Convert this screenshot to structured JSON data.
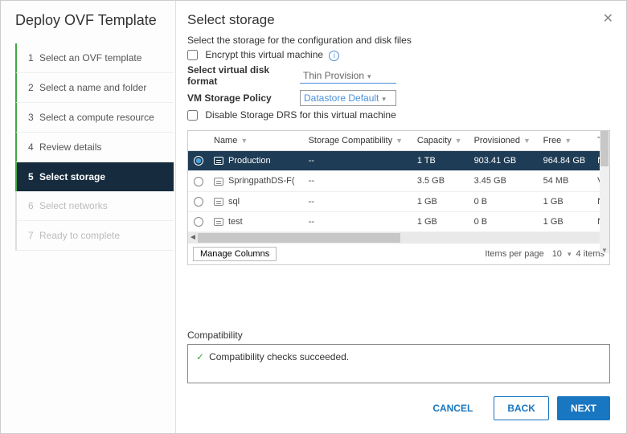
{
  "wizard": {
    "title": "Deploy OVF Template",
    "steps": [
      {
        "num": "1",
        "label": "Select an OVF template",
        "state": "done"
      },
      {
        "num": "2",
        "label": "Select a name and folder",
        "state": "done"
      },
      {
        "num": "3",
        "label": "Select a compute resource",
        "state": "done"
      },
      {
        "num": "4",
        "label": "Review details",
        "state": "done"
      },
      {
        "num": "5",
        "label": "Select storage",
        "state": "current"
      },
      {
        "num": "6",
        "label": "Select networks",
        "state": "future"
      },
      {
        "num": "7",
        "label": "Ready to complete",
        "state": "future"
      }
    ]
  },
  "page": {
    "title": "Select storage",
    "desc": "Select the storage for the configuration and disk files",
    "encrypt_label": "Encrypt this virtual machine",
    "format_label": "Select virtual disk format",
    "format_value": "Thin Provision",
    "policy_label": "VM Storage Policy",
    "policy_value": "Datastore Default",
    "drs_label": "Disable Storage DRS for this virtual machine"
  },
  "table": {
    "headers": {
      "name": "Name",
      "storage_compat": "Storage Compatibility",
      "capacity": "Capacity",
      "provisioned": "Provisioned",
      "free": "Free",
      "t": "T"
    },
    "rows": [
      {
        "name": "Production",
        "compat": "--",
        "capacity": "1 TB",
        "provisioned": "903.41 GB",
        "free": "964.84 GB",
        "t": "N",
        "selected": true
      },
      {
        "name": "SpringpathDS-F(",
        "compat": "--",
        "capacity": "3.5 GB",
        "provisioned": "3.45 GB",
        "free": "54 MB",
        "t": "V",
        "selected": false
      },
      {
        "name": "sql",
        "compat": "--",
        "capacity": "1 GB",
        "provisioned": "0 B",
        "free": "1 GB",
        "t": "N",
        "selected": false
      },
      {
        "name": "test",
        "compat": "--",
        "capacity": "1 GB",
        "provisioned": "0 B",
        "free": "1 GB",
        "t": "N",
        "selected": false
      }
    ],
    "manage_columns": "Manage Columns",
    "items_per_page_label": "Items per page",
    "items_per_page_value": "10",
    "count": "4 items"
  },
  "compat": {
    "label": "Compatibility",
    "message": "Compatibility checks succeeded."
  },
  "footer": {
    "cancel": "CANCEL",
    "back": "BACK",
    "next": "NEXT"
  }
}
